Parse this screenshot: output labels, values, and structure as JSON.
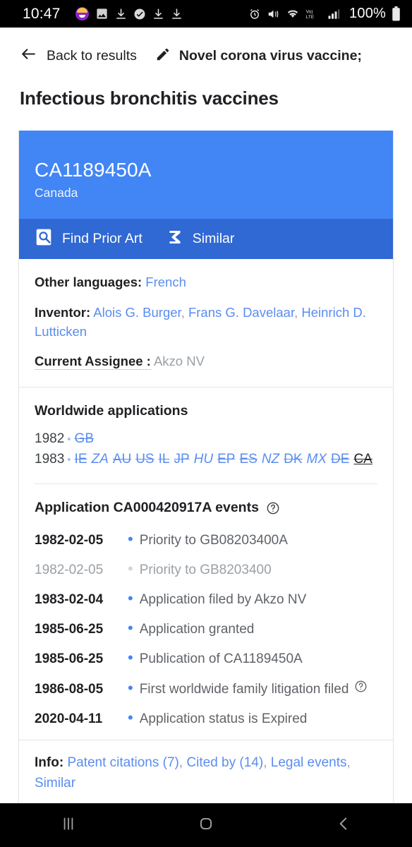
{
  "statusbar": {
    "time": "10:47",
    "battery_text": "100%",
    "network_label": "LTE",
    "volte_label": "Vo)",
    "left_icons": [
      "emoji-avatar-icon",
      "photo-icon",
      "download-icon",
      "check-circle-icon",
      "download-icon",
      "download-icon"
    ],
    "right_icons": [
      "alarm-icon",
      "mute-vibrate-icon",
      "wifi-icon",
      "volte-icon",
      "signal-bars-icon",
      "battery-icon"
    ]
  },
  "topbar": {
    "back_label": "Back to results",
    "back_icon": "arrow-left-icon",
    "edit_icon": "pencil-icon",
    "query_text": "Novel corona virus vaccine;"
  },
  "page": {
    "title": "Infectious bronchitis vaccines"
  },
  "patent": {
    "number": "CA1189450A",
    "country": "Canada",
    "actions": [
      {
        "label": "Find Prior Art",
        "icon": "prior-art-search-icon"
      },
      {
        "label": "Similar",
        "icon": "sigma-icon"
      }
    ],
    "other_languages_key": "Other languages:",
    "other_languages_value": "French",
    "inventor_key": "Inventor:",
    "inventors": [
      "Alois G. Burger",
      "Frans G. Davelaar",
      "Heinrich D. Lutticken"
    ],
    "assignee_key": "Current Assignee :",
    "assignee_value": "Akzo NV"
  },
  "worldwide": {
    "title": "Worldwide applications",
    "groups": [
      {
        "year": "1982",
        "codes": [
          {
            "code": "GB",
            "strike": true,
            "italic": false,
            "current": false
          }
        ]
      },
      {
        "year": "1983",
        "codes": [
          {
            "code": "IE",
            "strike": true,
            "italic": false,
            "current": false
          },
          {
            "code": "ZA",
            "strike": false,
            "italic": true,
            "current": false
          },
          {
            "code": "AU",
            "strike": true,
            "italic": false,
            "current": false
          },
          {
            "code": "US",
            "strike": true,
            "italic": false,
            "current": false
          },
          {
            "code": "IL",
            "strike": true,
            "italic": false,
            "current": false
          },
          {
            "code": "JP",
            "strike": true,
            "italic": false,
            "current": false
          },
          {
            "code": "HU",
            "strike": false,
            "italic": true,
            "current": false
          },
          {
            "code": "EP",
            "strike": true,
            "italic": false,
            "current": false
          },
          {
            "code": "ES",
            "strike": true,
            "italic": false,
            "current": false
          },
          {
            "code": "NZ",
            "strike": false,
            "italic": true,
            "current": false
          },
          {
            "code": "DK",
            "strike": true,
            "italic": false,
            "current": false
          },
          {
            "code": "MX",
            "strike": false,
            "italic": true,
            "current": false
          },
          {
            "code": "DE",
            "strike": true,
            "italic": false,
            "current": false
          },
          {
            "code": "CA",
            "strike": true,
            "italic": false,
            "current": true
          }
        ]
      }
    ]
  },
  "events": {
    "title": "Application CA000420917A events",
    "help_icon": "help-circle-icon",
    "rows": [
      {
        "date": "1982-02-05",
        "text": "Priority to GB08203400A",
        "muted": false,
        "help": false
      },
      {
        "date": "1982-02-05",
        "text": "Priority to GB8203400",
        "muted": true,
        "help": false
      },
      {
        "date": "1983-02-04",
        "text": "Application filed by Akzo NV",
        "muted": false,
        "help": false
      },
      {
        "date": "1985-06-25",
        "text": "Application granted",
        "muted": false,
        "help": false
      },
      {
        "date": "1985-06-25",
        "text": "Publication of CA1189450A",
        "muted": false,
        "help": false
      },
      {
        "date": "1986-08-05",
        "text": "First worldwide family litigation filed",
        "muted": false,
        "help": true
      },
      {
        "date": "2020-04-11",
        "text": "Application status is Expired",
        "muted": false,
        "help": false
      }
    ]
  },
  "info": {
    "key": "Info:",
    "links": [
      "Patent citations (7)",
      "Cited by (14)",
      "Legal events",
      "Similar"
    ]
  },
  "navbar": {
    "recents_icon": "recents-icon",
    "home_icon": "home-icon",
    "back_icon": "nav-back-icon"
  },
  "colors": {
    "accent": "#4285f4",
    "action_bar": "#3068d4",
    "link": "#5a8df0",
    "muted": "#9aa0a6"
  }
}
